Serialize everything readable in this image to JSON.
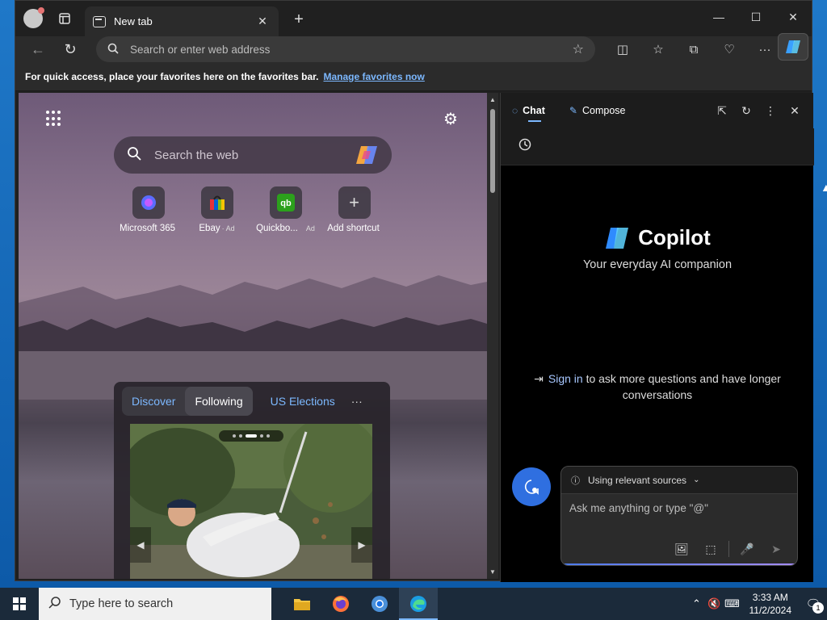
{
  "browser": {
    "tab_title": "New tab",
    "address_placeholder": "Search or enter web address",
    "favorites_bar": {
      "text": "For quick access, place your favorites here on the favorites bar.",
      "link": "Manage favorites now"
    }
  },
  "newtab": {
    "search_placeholder": "Search the web",
    "shortcuts": [
      {
        "label": "Microsoft 365",
        "ad": ""
      },
      {
        "label": "Ebay",
        "ad": "· Ad"
      },
      {
        "label": "Quickbo...",
        "ad": "Ad"
      },
      {
        "label": "Add shortcut",
        "ad": ""
      }
    ],
    "feed": {
      "tabs": [
        "Discover",
        "Following",
        "US Elections"
      ],
      "more": "···"
    }
  },
  "copilot": {
    "tabs": {
      "chat": "Chat",
      "compose": "Compose"
    },
    "title": "Copilot",
    "subtitle": "Your everyday AI companion",
    "signin_link": "Sign in",
    "signin_text": " to ask more questions and have longer conversations",
    "sources_label": "Using relevant sources",
    "input_placeholder": "Ask me anything or type \"@\""
  },
  "taskbar": {
    "search_text": "Type here to search",
    "time": "3:33 AM",
    "date": "11/2/2024",
    "notification_count": "1"
  },
  "colors": {
    "accent": "#7cb8ff",
    "copilot_blue": "#2f6fe0",
    "desktop": "#1f78c8"
  }
}
